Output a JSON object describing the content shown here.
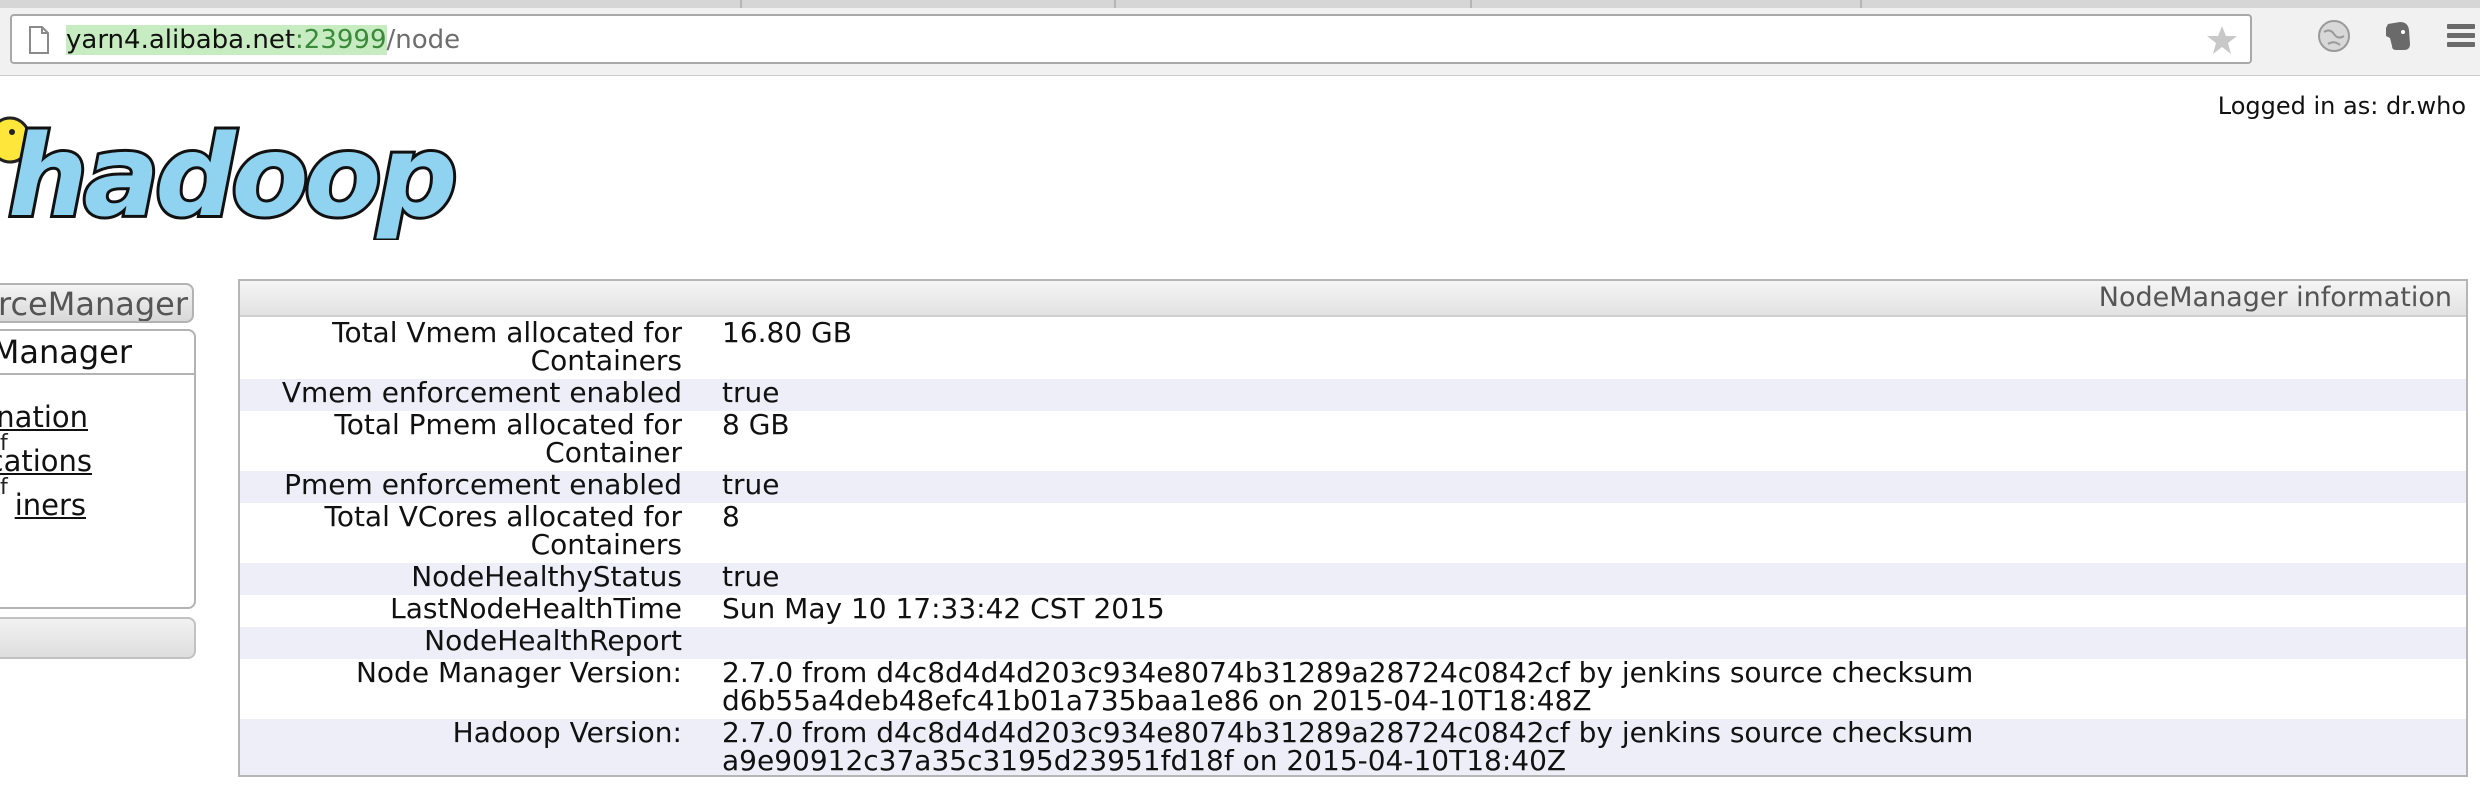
{
  "browser": {
    "url_host": "yarn4.alibaba.net",
    "url_port": ":23999",
    "url_path": "/node"
  },
  "header": {
    "logged_in": "Logged in as: dr.who",
    "logo_text": "hadoop"
  },
  "nav": {
    "resourcemanager_label": "ResourceManager",
    "nodemanager_label": "NodeManager",
    "links": [
      {
        "label": "Node Information"
      },
      {
        "label": "List of Applications"
      },
      {
        "label": "List of Containers"
      }
    ],
    "visible_fragments": {
      "resourcemanager": "urceManager",
      "nodemanager": "Manager",
      "link_1": "nation",
      "link_1_small": "f",
      "link_2": "cations",
      "link_2_small": "f",
      "link_3": "iners"
    }
  },
  "info": {
    "header": "NodeManager information",
    "rows": [
      {
        "key": "Total Vmem allocated for Containers",
        "value": "16.80 GB"
      },
      {
        "key": "Vmem enforcement enabled",
        "value": "true"
      },
      {
        "key": "Total Pmem allocated for Container",
        "value": "8 GB"
      },
      {
        "key": "Pmem enforcement enabled",
        "value": "true"
      },
      {
        "key": "Total VCores allocated for Containers",
        "value": "8"
      },
      {
        "key": "NodeHealthyStatus",
        "value": "true"
      },
      {
        "key": "LastNodeHealthTime",
        "value": "Sun May 10 17:33:42 CST 2015"
      },
      {
        "key": "NodeHealthReport",
        "value": ""
      },
      {
        "key": "Node Manager Version:",
        "value": "2.7.0 from d4c8d4d4d203c934e8074b31289a28724c0842cf by jenkins source checksum d6b55a4deb48efc41b01a735baa1e86 on 2015-04-10T18:48Z"
      },
      {
        "key": "Hadoop Version:",
        "value": "2.7.0 from d4c8d4d4d203c934e8074b31289a28724c0842cf by jenkins source checksum a9e90912c37a35c3195d23951fd18f on 2015-04-10T18:40Z"
      }
    ]
  },
  "colors": {
    "url_highlight": "#c8ecc1",
    "row_alt": "#eeeef8",
    "logo_blue": "#8fd3f0",
    "logo_yellow": "#ffe63b"
  }
}
